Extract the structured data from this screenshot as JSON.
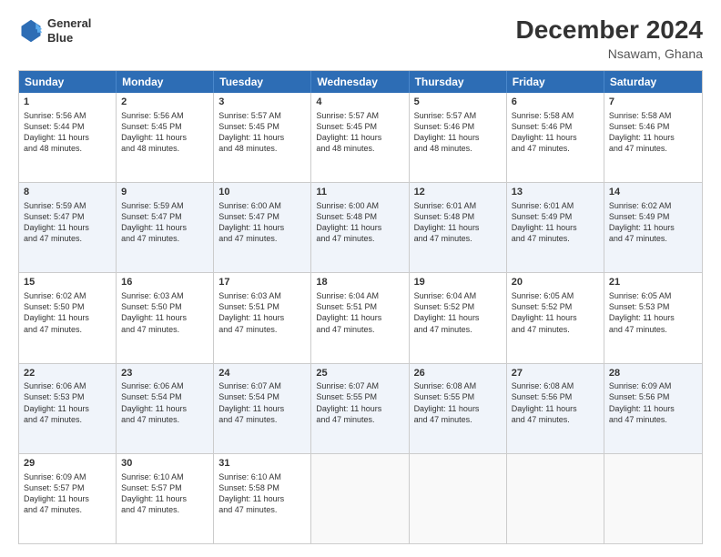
{
  "header": {
    "logo_line1": "General",
    "logo_line2": "Blue",
    "month_title": "December 2024",
    "location": "Nsawam, Ghana"
  },
  "days_of_week": [
    "Sunday",
    "Monday",
    "Tuesday",
    "Wednesday",
    "Thursday",
    "Friday",
    "Saturday"
  ],
  "weeks": [
    [
      {
        "day": "1",
        "info": "Sunrise: 5:56 AM\nSunset: 5:44 PM\nDaylight: 11 hours\nand 48 minutes."
      },
      {
        "day": "2",
        "info": "Sunrise: 5:56 AM\nSunset: 5:45 PM\nDaylight: 11 hours\nand 48 minutes."
      },
      {
        "day": "3",
        "info": "Sunrise: 5:57 AM\nSunset: 5:45 PM\nDaylight: 11 hours\nand 48 minutes."
      },
      {
        "day": "4",
        "info": "Sunrise: 5:57 AM\nSunset: 5:45 PM\nDaylight: 11 hours\nand 48 minutes."
      },
      {
        "day": "5",
        "info": "Sunrise: 5:57 AM\nSunset: 5:46 PM\nDaylight: 11 hours\nand 48 minutes."
      },
      {
        "day": "6",
        "info": "Sunrise: 5:58 AM\nSunset: 5:46 PM\nDaylight: 11 hours\nand 47 minutes."
      },
      {
        "day": "7",
        "info": "Sunrise: 5:58 AM\nSunset: 5:46 PM\nDaylight: 11 hours\nand 47 minutes."
      }
    ],
    [
      {
        "day": "8",
        "info": "Sunrise: 5:59 AM\nSunset: 5:47 PM\nDaylight: 11 hours\nand 47 minutes."
      },
      {
        "day": "9",
        "info": "Sunrise: 5:59 AM\nSunset: 5:47 PM\nDaylight: 11 hours\nand 47 minutes."
      },
      {
        "day": "10",
        "info": "Sunrise: 6:00 AM\nSunset: 5:47 PM\nDaylight: 11 hours\nand 47 minutes."
      },
      {
        "day": "11",
        "info": "Sunrise: 6:00 AM\nSunset: 5:48 PM\nDaylight: 11 hours\nand 47 minutes."
      },
      {
        "day": "12",
        "info": "Sunrise: 6:01 AM\nSunset: 5:48 PM\nDaylight: 11 hours\nand 47 minutes."
      },
      {
        "day": "13",
        "info": "Sunrise: 6:01 AM\nSunset: 5:49 PM\nDaylight: 11 hours\nand 47 minutes."
      },
      {
        "day": "14",
        "info": "Sunrise: 6:02 AM\nSunset: 5:49 PM\nDaylight: 11 hours\nand 47 minutes."
      }
    ],
    [
      {
        "day": "15",
        "info": "Sunrise: 6:02 AM\nSunset: 5:50 PM\nDaylight: 11 hours\nand 47 minutes."
      },
      {
        "day": "16",
        "info": "Sunrise: 6:03 AM\nSunset: 5:50 PM\nDaylight: 11 hours\nand 47 minutes."
      },
      {
        "day": "17",
        "info": "Sunrise: 6:03 AM\nSunset: 5:51 PM\nDaylight: 11 hours\nand 47 minutes."
      },
      {
        "day": "18",
        "info": "Sunrise: 6:04 AM\nSunset: 5:51 PM\nDaylight: 11 hours\nand 47 minutes."
      },
      {
        "day": "19",
        "info": "Sunrise: 6:04 AM\nSunset: 5:52 PM\nDaylight: 11 hours\nand 47 minutes."
      },
      {
        "day": "20",
        "info": "Sunrise: 6:05 AM\nSunset: 5:52 PM\nDaylight: 11 hours\nand 47 minutes."
      },
      {
        "day": "21",
        "info": "Sunrise: 6:05 AM\nSunset: 5:53 PM\nDaylight: 11 hours\nand 47 minutes."
      }
    ],
    [
      {
        "day": "22",
        "info": "Sunrise: 6:06 AM\nSunset: 5:53 PM\nDaylight: 11 hours\nand 47 minutes."
      },
      {
        "day": "23",
        "info": "Sunrise: 6:06 AM\nSunset: 5:54 PM\nDaylight: 11 hours\nand 47 minutes."
      },
      {
        "day": "24",
        "info": "Sunrise: 6:07 AM\nSunset: 5:54 PM\nDaylight: 11 hours\nand 47 minutes."
      },
      {
        "day": "25",
        "info": "Sunrise: 6:07 AM\nSunset: 5:55 PM\nDaylight: 11 hours\nand 47 minutes."
      },
      {
        "day": "26",
        "info": "Sunrise: 6:08 AM\nSunset: 5:55 PM\nDaylight: 11 hours\nand 47 minutes."
      },
      {
        "day": "27",
        "info": "Sunrise: 6:08 AM\nSunset: 5:56 PM\nDaylight: 11 hours\nand 47 minutes."
      },
      {
        "day": "28",
        "info": "Sunrise: 6:09 AM\nSunset: 5:56 PM\nDaylight: 11 hours\nand 47 minutes."
      }
    ],
    [
      {
        "day": "29",
        "info": "Sunrise: 6:09 AM\nSunset: 5:57 PM\nDaylight: 11 hours\nand 47 minutes."
      },
      {
        "day": "30",
        "info": "Sunrise: 6:10 AM\nSunset: 5:57 PM\nDaylight: 11 hours\nand 47 minutes."
      },
      {
        "day": "31",
        "info": "Sunrise: 6:10 AM\nSunset: 5:58 PM\nDaylight: 11 hours\nand 47 minutes."
      },
      {
        "day": "",
        "info": ""
      },
      {
        "day": "",
        "info": ""
      },
      {
        "day": "",
        "info": ""
      },
      {
        "day": "",
        "info": ""
      }
    ]
  ]
}
